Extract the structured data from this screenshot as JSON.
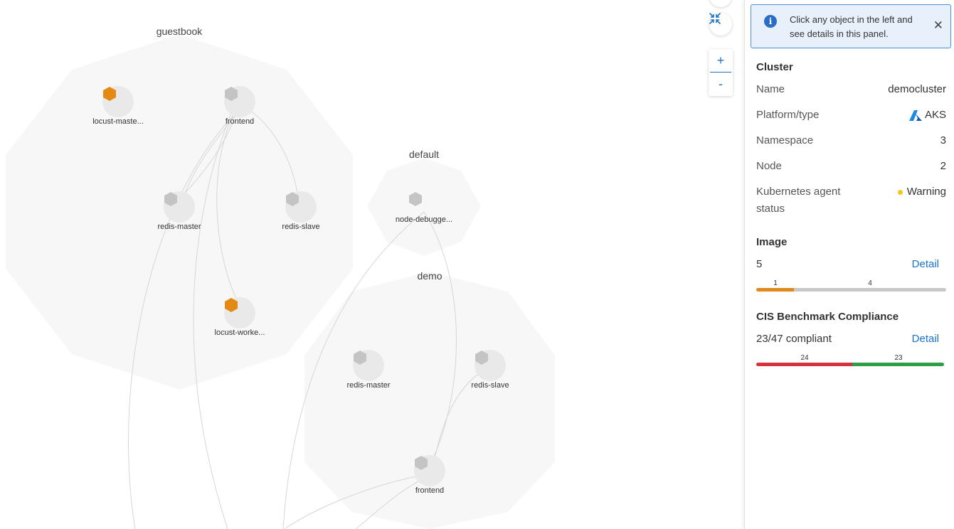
{
  "namespaces": [
    {
      "label": "guestbook"
    },
    {
      "label": "default"
    },
    {
      "label": "demo"
    }
  ],
  "nodes": [
    {
      "label": "locust-maste...",
      "status": "warning"
    },
    {
      "label": "frontend",
      "status": "normal"
    },
    {
      "label": "redis-master",
      "status": "normal"
    },
    {
      "label": "redis-slave",
      "status": "normal"
    },
    {
      "label": "locust-worke...",
      "status": "warning"
    },
    {
      "label": "node-debugge...",
      "status": "normal"
    },
    {
      "label": "redis-master",
      "status": "normal"
    },
    {
      "label": "redis-slave",
      "status": "normal"
    },
    {
      "label": "frontend",
      "status": "normal"
    }
  ],
  "controls": {
    "fit_icon": "fit-to-screen-icon",
    "zoom_in_label": "+",
    "zoom_out_label": "-"
  },
  "panel": {
    "info": {
      "text": "Click any object in the left and see details in this panel.",
      "close_label": "✕"
    },
    "cluster": {
      "title": "Cluster",
      "rows": [
        {
          "label": "Name",
          "value": "democluster"
        },
        {
          "label": "Platform/type",
          "value": "AKS"
        },
        {
          "label": "Namespace",
          "value": "3"
        },
        {
          "label": "Node",
          "value": "2"
        },
        {
          "label": "Kubernetes agent status",
          "value": "Warning"
        }
      ]
    },
    "image": {
      "title": "Image",
      "count": "5",
      "detail_label": "Detail",
      "bar": [
        {
          "label": "1",
          "value": 1,
          "color": "#e08a1e"
        },
        {
          "label": "4",
          "value": 4,
          "color": "#c8c8c8"
        }
      ]
    },
    "cis": {
      "title": "CIS Benchmark Compliance",
      "summary": "23/47 compliant",
      "detail_label": "Detail",
      "bar": [
        {
          "label": "24",
          "value": 24,
          "color": "#d6323e"
        },
        {
          "label": "23",
          "value": 23,
          "color": "#2e9e45"
        }
      ]
    }
  },
  "colors": {
    "warning": "#e38a14",
    "normal": "#c4c4c4",
    "accent": "#1a73c7",
    "status_warning_dot": "#f5c518"
  }
}
